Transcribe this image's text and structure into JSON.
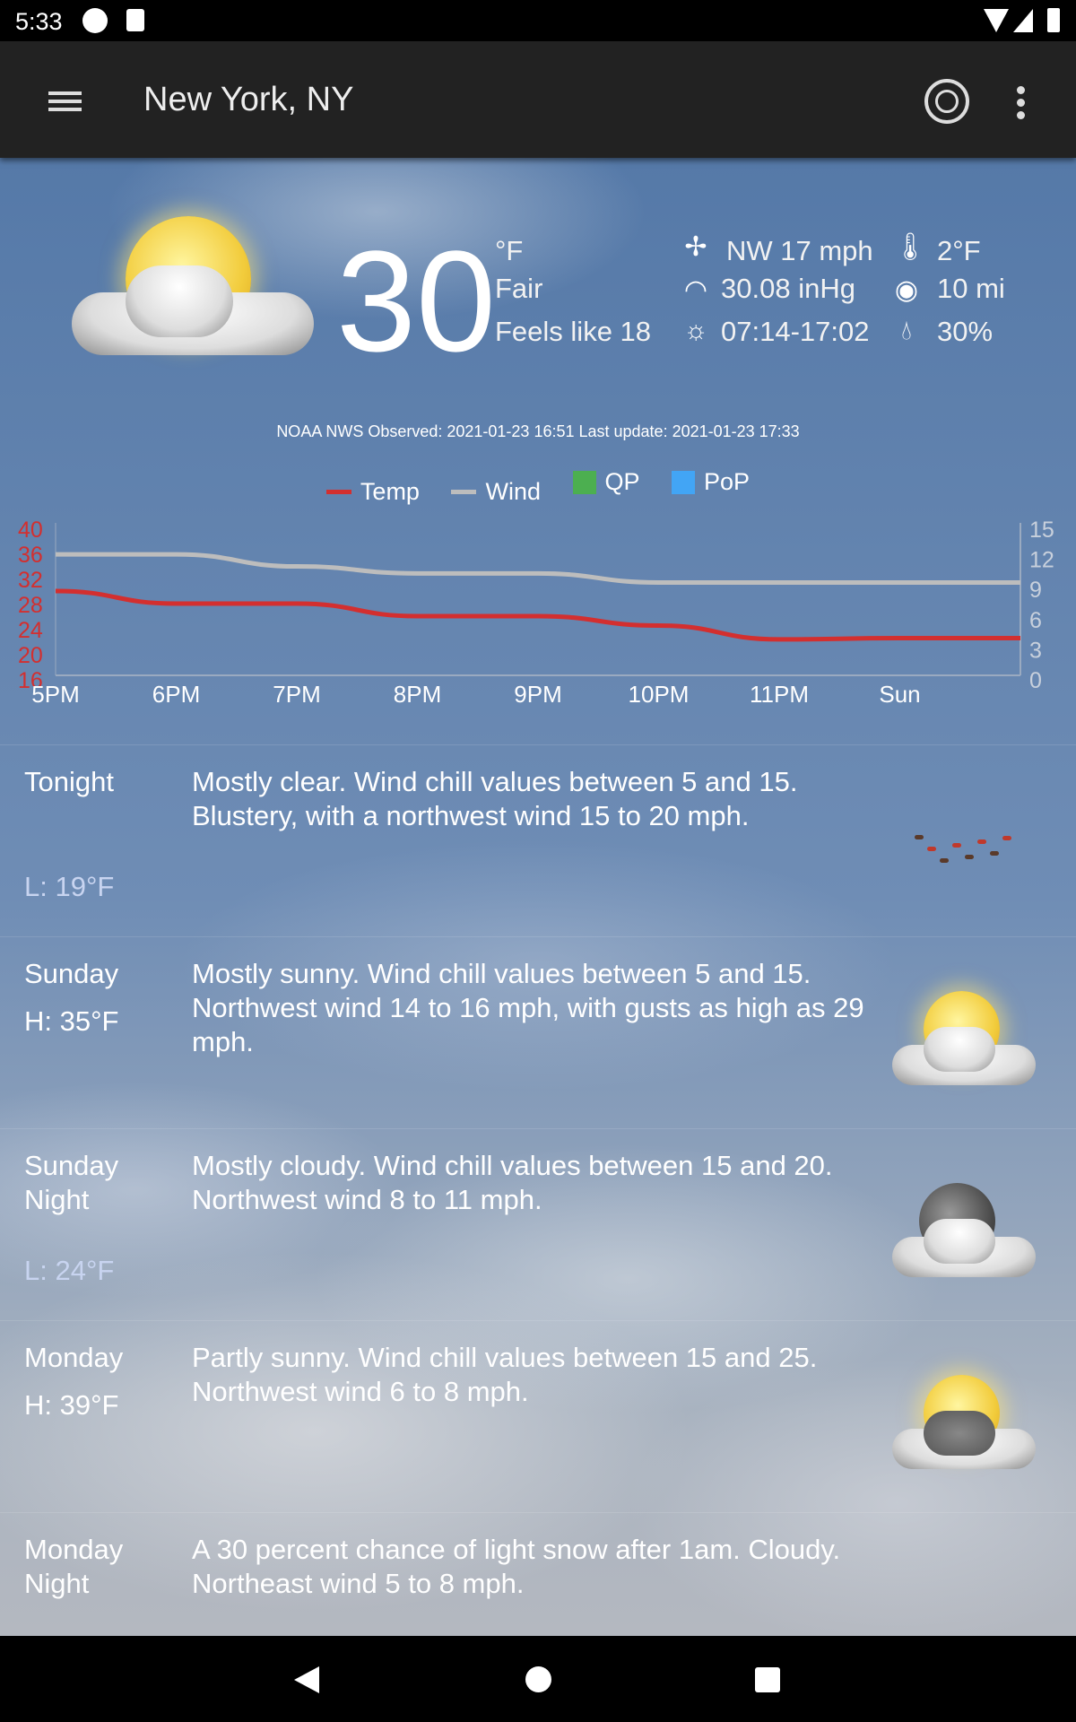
{
  "status_bar": {
    "time": "5:33"
  },
  "app_bar": {
    "title": "New York, NY",
    "radar_icon": "radar-icon",
    "menu_icon": "hamburger-icon",
    "more_icon": "more-vert-icon"
  },
  "current": {
    "temp": "30",
    "unit": "°F",
    "condition": "Fair",
    "feels_like": "Feels like 18",
    "wind": "NW 17 mph",
    "pressure": "30.08 inHg",
    "sun": "07:14-17:02",
    "dewpoint": "2°F",
    "visibility": "10 mi",
    "humidity": "30%",
    "observed": "NOAA NWS Observed: 2021-01-23 16:51  Last update: 2021-01-23 17:33"
  },
  "legend": [
    {
      "label": "Temp",
      "color": "#d32f2f"
    },
    {
      "label": "Wind",
      "color": "#bdbdbd"
    },
    {
      "label": "QP",
      "color": "#4caf50"
    },
    {
      "label": "PoP",
      "color": "#42a5f5"
    }
  ],
  "chart_data": {
    "type": "line",
    "categories": [
      "5PM",
      "6PM",
      "7PM",
      "8PM",
      "9PM",
      "10PM",
      "11PM",
      "Sun",
      ""
    ],
    "left_axis": {
      "ticks": [
        "40",
        "36",
        "32",
        "28",
        "24",
        "20",
        "16"
      ],
      "range": [
        16,
        40
      ],
      "color": "#d32f2f"
    },
    "right_axis": {
      "ticks": [
        "15",
        "12",
        "9",
        "6",
        "3",
        "0"
      ],
      "range": [
        0,
        15
      ]
    },
    "series": [
      {
        "name": "Temp",
        "color": "#d32f2f",
        "values": [
          30,
          28,
          28,
          26,
          26,
          24.5,
          22.3,
          22.5,
          22.5
        ]
      },
      {
        "name": "Wind",
        "color": "#bdbdbd",
        "values": [
          12.4,
          12.4,
          11.2,
          10.5,
          10.5,
          9.6,
          9.6,
          9.6,
          9.6
        ]
      }
    ]
  },
  "forecast": [
    {
      "day": "Tonight",
      "hl": "L: 19°F",
      "hl_type": "low",
      "desc": "Mostly clear. Wind chill values between 5 and 15. Blustery, with a northwest wind 15 to 20 mph.",
      "icon": "wind-leaves-icon"
    },
    {
      "day": "Sunday",
      "hl": "H: 35°F",
      "hl_type": "high",
      "desc": "Mostly sunny. Wind chill values between 5 and 15. Northwest wind 14 to 16 mph, with gusts as high as 29 mph.",
      "icon": "sun-cloud-icon"
    },
    {
      "day": "Sunday Night",
      "hl": "L: 24°F",
      "hl_type": "low",
      "desc": "Mostly cloudy. Wind chill values between 15 and 20. Northwest wind 8 to 11 mph.",
      "icon": "moon-cloud-icon"
    },
    {
      "day": "Monday",
      "hl": "H: 39°F",
      "hl_type": "high",
      "desc": "Partly sunny. Wind chill values between 15 and 25. Northwest wind 6 to 8 mph.",
      "icon": "sun-dark-cloud-icon"
    },
    {
      "day": "Monday Night",
      "hl": "",
      "hl_type": "low",
      "desc": "A 30 percent chance of light snow after 1am.  Cloudy. Northeast wind 5 to 8 mph.",
      "icon": "moon-cloud-icon"
    }
  ]
}
